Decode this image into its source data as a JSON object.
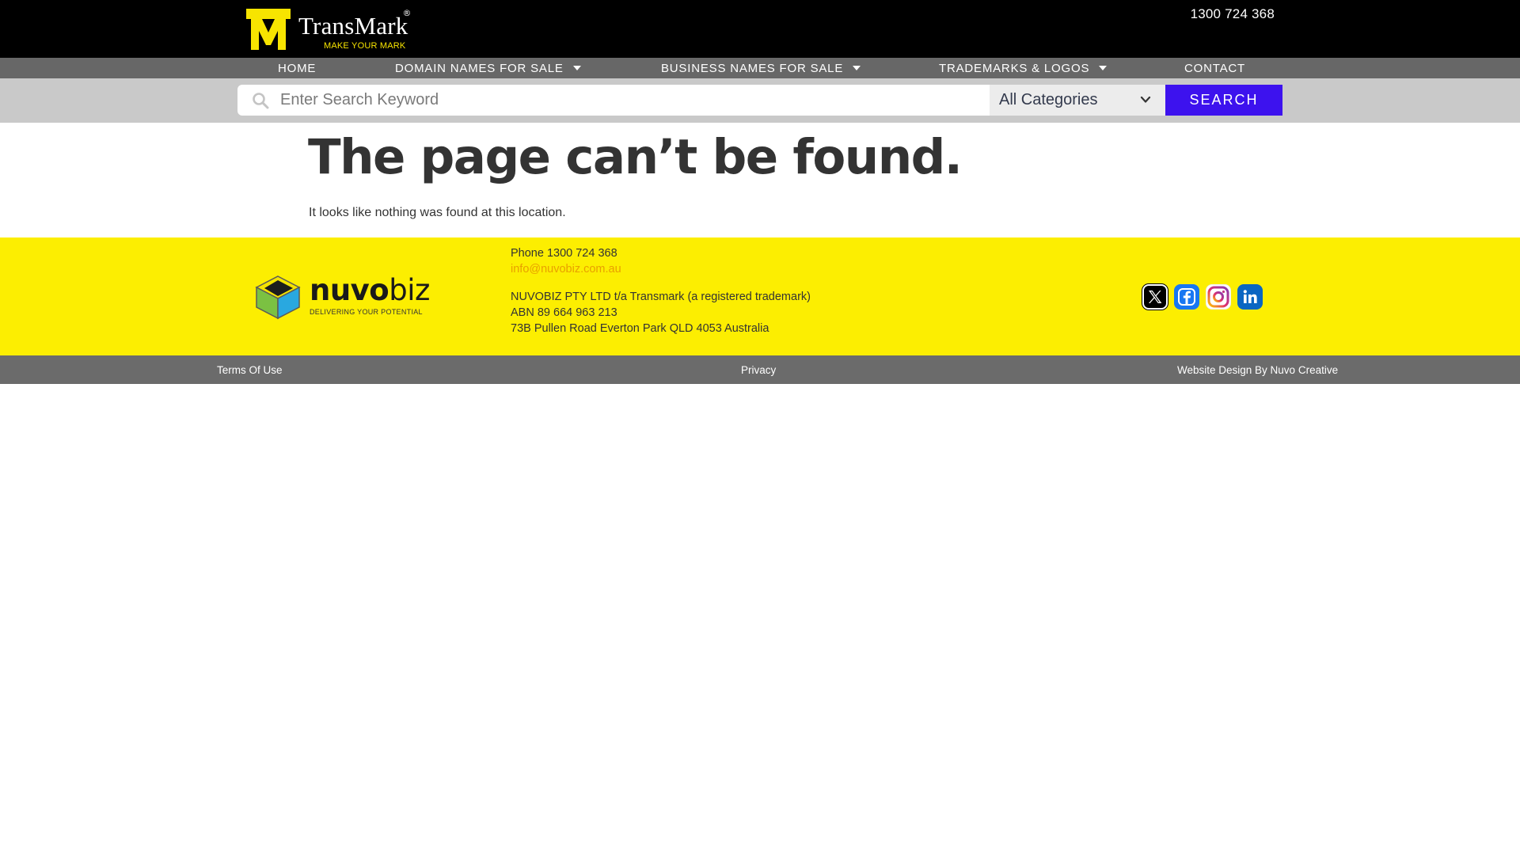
{
  "header": {
    "logo_name": "TransMark",
    "logo_registered": "®",
    "logo_tagline": "MAKE YOUR MARK",
    "phone": "1300 724 368"
  },
  "nav": {
    "items": [
      {
        "label": "HOME",
        "has_dropdown": false
      },
      {
        "label": "DOMAIN NAMES FOR SALE",
        "has_dropdown": true
      },
      {
        "label": "BUSINESS NAMES FOR SALE",
        "has_dropdown": true
      },
      {
        "label": "TRADEMARKS & LOGOS",
        "has_dropdown": true
      },
      {
        "label": "CONTACT",
        "has_dropdown": false
      }
    ]
  },
  "search": {
    "placeholder": "Enter Search Keyword",
    "value": "",
    "category_selected": "All Categories",
    "button_label": "SEARCH"
  },
  "main": {
    "title": "The page can’t be found.",
    "message": "It looks like nothing was found at this location."
  },
  "footer": {
    "brand_name_bold": "nuvo",
    "brand_name_light": "biz",
    "brand_tagline": "DELIVERING YOUR POTENTIAL",
    "phone_line": "Phone 1300 724 368",
    "email": "info@nuvobiz.com.au",
    "company_line": "NUVOBIZ PTY LTD t/a Transmark (a registered trademark)",
    "abn_line": "ABN 89 664 963 213",
    "address_line": "73B Pullen Road Everton Park QLD 4053 Australia",
    "social_icons": [
      "x-icon",
      "facebook-icon",
      "instagram-icon",
      "linkedin-icon"
    ]
  },
  "bottom": {
    "terms": "Terms Of Use",
    "privacy": "Privacy",
    "credit": "Website Design By Nuvo Creative"
  },
  "colors": {
    "header_bg": "#000000",
    "nav_bg": "#676767",
    "searchbar_bg": "#c9c9c9",
    "search_button": "#3d12ee",
    "footer_bg": "#fcee01",
    "bottombar_bg": "#6b6b6b",
    "brand_yellow": "#f7e400",
    "email_color": "#e9a000"
  }
}
